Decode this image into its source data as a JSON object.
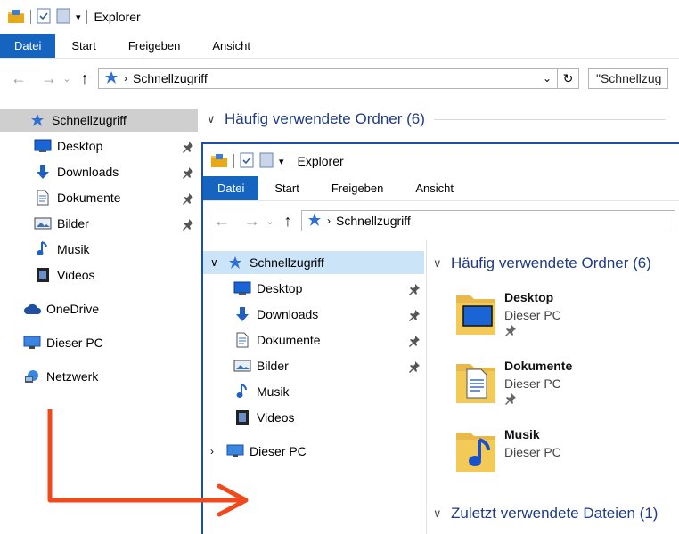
{
  "background_window": {
    "title": "Explorer",
    "ribbon_tabs": [
      "Datei",
      "Start",
      "Freigeben",
      "Ansicht"
    ],
    "address": "Schnellzugriff",
    "search_placeholder": "\"Schnellzug",
    "nav": {
      "quick_access": "Schnellzugriff",
      "items": [
        "Desktop",
        "Downloads",
        "Dokumente",
        "Bilder",
        "Musik",
        "Videos"
      ],
      "onedrive": "OneDrive",
      "this_pc": "Dieser PC",
      "network": "Netzwerk"
    },
    "section_frequent": "Häufig verwendete Ordner (6)"
  },
  "foreground_window": {
    "title": "Explorer",
    "ribbon_tabs": [
      "Datei",
      "Start",
      "Freigeben",
      "Ansicht"
    ],
    "address": "Schnellzugriff",
    "nav": {
      "quick_access": "Schnellzugriff",
      "items": [
        "Desktop",
        "Downloads",
        "Dokumente",
        "Bilder",
        "Musik",
        "Videos"
      ],
      "this_pc": "Dieser PC"
    },
    "section_frequent": "Häufig verwendete Ordner (6)",
    "folders": [
      {
        "name": "Desktop",
        "location": "Dieser PC"
      },
      {
        "name": "Dokumente",
        "location": "Dieser PC"
      },
      {
        "name": "Musik",
        "location": "Dieser PC"
      }
    ],
    "section_recent": "Zuletzt verwendete Dateien (1)"
  },
  "colors": {
    "accent": "#1565c0",
    "selection_bg": "#cfcfcf",
    "selection_fg": "#cce4f7",
    "arrow": "#f04a1c",
    "section_heading": "#1e3a8a"
  }
}
